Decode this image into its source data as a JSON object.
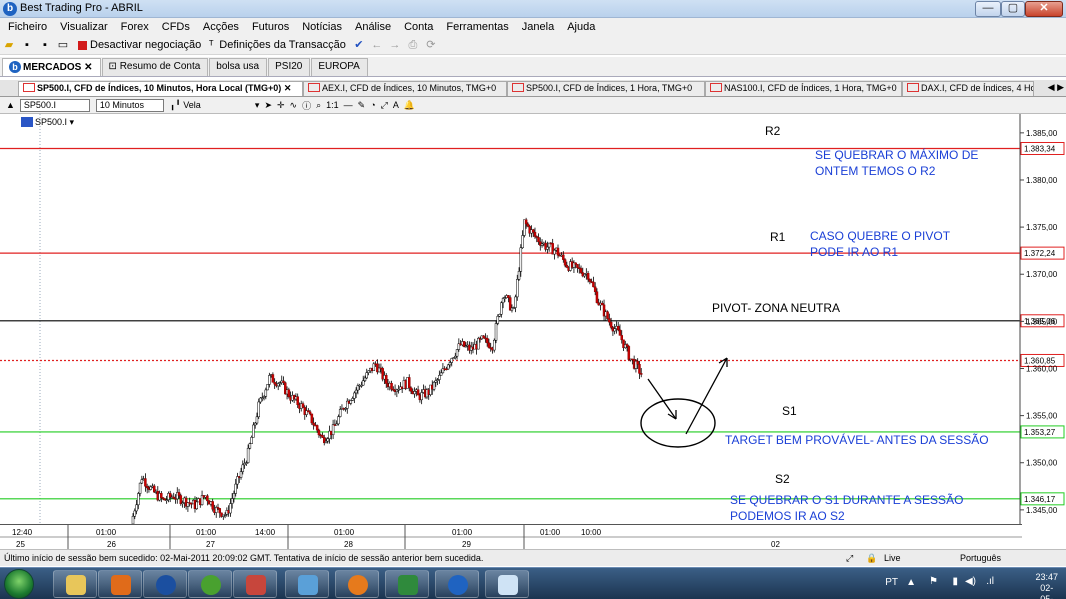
{
  "window": {
    "title": "Best Trading Pro - ABRIL",
    "app_icon": "b",
    "controls": {
      "minimize": "—",
      "maximize": "▢",
      "close": "✕"
    }
  },
  "menu": [
    "Ficheiro",
    "Visualizar",
    "Forex",
    "CFDs",
    "Acções",
    "Futuros",
    "Notícias",
    "Análise",
    "Conta",
    "Ferramentas",
    "Janela",
    "Ajuda"
  ],
  "toolbar": {
    "deactivate_label": "Desactivar negociação",
    "settings_label": "Definições da Transacção"
  },
  "workspace_tabs": [
    {
      "label": "MERCADOS",
      "active": true
    },
    {
      "label": "Resumo de Conta",
      "active": false
    },
    {
      "label": "bolsa usa",
      "active": false
    },
    {
      "label": "PSI20",
      "active": false
    },
    {
      "label": "EUROPA",
      "active": false
    }
  ],
  "chart_tabs": [
    {
      "label": "SP500.I, CFD de Índices, 10 Minutos, Hora Local (TMG+0)",
      "active": true
    },
    {
      "label": "AEX.I, CFD de Índices, 10 Minutos, TMG+0",
      "active": false
    },
    {
      "label": "SP500.I, CFD de Índices, 1 Hora, TMG+0",
      "active": false
    },
    {
      "label": "NAS100.I, CFD de Índices, 1 Hora, TMG+0",
      "active": false
    },
    {
      "label": "DAX.I, CFD de Índices, 4 Hora",
      "active": false
    }
  ],
  "chart_toolbar": {
    "symbol": "SP500.I",
    "timeframe": "10 Minutos",
    "chart_type": "Vela"
  },
  "chart_data": {
    "type": "candlestick",
    "symbol_label": "SP500.I",
    "ylim": [
      1343.5,
      1387.0
    ],
    "y_ticks": [
      "1.385,00",
      "1.380,00",
      "1.375,00",
      "1.370,00",
      "1.365,00",
      "1.360,00",
      "1.355,00",
      "1.350,00",
      "1.345,00"
    ],
    "y_tick_values": [
      1385,
      1380,
      1375,
      1370,
      1365,
      1360,
      1355,
      1350,
      1345
    ],
    "levels": [
      {
        "value": 1383.34,
        "label": "1.383,34",
        "color": "#e02020",
        "style": "solid"
      },
      {
        "value": 1372.24,
        "label": "1.372,24",
        "color": "#e02020",
        "style": "solid"
      },
      {
        "value": 1365.06,
        "label": "1.365,06",
        "color": "#000000",
        "style": "solid"
      },
      {
        "value": 1360.85,
        "label": "1.360,85",
        "color": "#e02020",
        "style": "dotted"
      },
      {
        "value": 1353.27,
        "label": "1.353,27",
        "color": "#22cc22",
        "style": "solid"
      },
      {
        "value": 1346.17,
        "label": "1.346,17",
        "color": "#22cc22",
        "style": "solid"
      }
    ],
    "current_price_label": "1.360,85",
    "annotations": [
      {
        "text": "R2",
        "color": "#000000"
      },
      {
        "text": "SE QUEBRAR O MÁXIMO DE",
        "color": "#1a3fd6"
      },
      {
        "text": "ONTEM TEMOS O R2",
        "color": "#1a3fd6"
      },
      {
        "text": "R1",
        "color": "#000000"
      },
      {
        "text": "CASO QUEBRE O PIVOT",
        "color": "#1a3fd6"
      },
      {
        "text": "PODE IR AO R1",
        "color": "#1a3fd6"
      },
      {
        "text": "PIVOT- ZONA NEUTRA",
        "color": "#000000"
      },
      {
        "text": "S1",
        "color": "#000000"
      },
      {
        "text": "TARGET BEM PROVÁVEL- ANTES DA SESSÃO",
        "color": "#1a3fd6"
      },
      {
        "text": "S2",
        "color": "#000000"
      },
      {
        "text": "SE QUEBRAR O S1 DURANTE A SESSÃO",
        "color": "#1a3fd6"
      },
      {
        "text": "PODEMOS IR AO S2",
        "color": "#1a3fd6"
      }
    ],
    "price_path": [
      1343.5,
      1348.5,
      1347.0,
      1346.0,
      1346.5,
      1346.0,
      1345.5,
      1346.5,
      1345.0,
      1344.5,
      1348.0,
      1351.0,
      1356.0,
      1359.0,
      1358.5,
      1357.0,
      1356.0,
      1354.5,
      1352.5,
      1353.5,
      1356.0,
      1357.5,
      1359.0,
      1360.5,
      1358.5,
      1358.0,
      1358.5,
      1357.0,
      1357.5,
      1359.0,
      1361.0,
      1362.5,
      1362.0,
      1363.0,
      1362.5,
      1368.0,
      1366.0,
      1375.5,
      1374.0,
      1373.0,
      1372.5,
      1371.0,
      1370.5,
      1370.0,
      1367.0,
      1365.0,
      1363.5,
      1361.0,
      1359.5
    ]
  },
  "time_axis": {
    "hours": [
      "12:40",
      "01:00",
      "01:00",
      "14:00",
      "01:00",
      "01:00",
      "01:00",
      "10:00"
    ],
    "days": [
      "25",
      "26",
      "27",
      "28",
      "29",
      "02"
    ]
  },
  "status": {
    "message": "Último início de sessão bem sucedido: 02-Mai-2011 20:09:02 GMT. Tentativa de início de sessão anterior bem sucedida.",
    "connection": "Live",
    "language": "Português"
  },
  "taskbar": {
    "tray_lang": "PT",
    "time": "23:47",
    "date": "02-05-2011"
  }
}
